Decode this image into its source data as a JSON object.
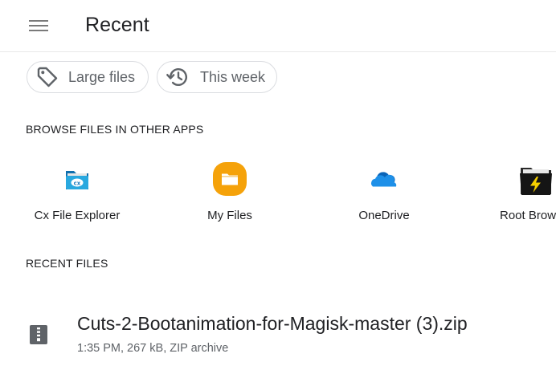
{
  "header": {
    "title": "Recent",
    "menu_icon": "hamburger-menu-icon"
  },
  "chips": [
    {
      "label": "Large files",
      "icon": "tag-icon"
    },
    {
      "label": "This week",
      "icon": "history-clock-icon"
    }
  ],
  "browse_section": {
    "label": "BROWSE FILES IN OTHER APPS",
    "apps": [
      {
        "label": "Cx File Explorer",
        "icon": "cx-file-explorer-icon",
        "color": "#1e9bd7"
      },
      {
        "label": "My Files",
        "icon": "my-files-folder-icon",
        "color": "#f5a20a"
      },
      {
        "label": "OneDrive",
        "icon": "onedrive-cloud-icon",
        "color": "#0a72c9"
      },
      {
        "label": "Root Brow",
        "icon": "root-browser-icon",
        "color": "#1c1c1c"
      }
    ]
  },
  "recent_section": {
    "label": "RECENT FILES",
    "files": [
      {
        "name": "Cuts-2-Bootanimation-for-Magisk-master (3).zip",
        "meta": "1:35 PM, 267 kB, ZIP archive",
        "icon": "zip-archive-icon"
      }
    ]
  },
  "colors": {
    "text_primary": "#202124",
    "text_secondary": "#5f6368",
    "chip_border": "#dadce0",
    "divider": "#e8e8e8"
  }
}
